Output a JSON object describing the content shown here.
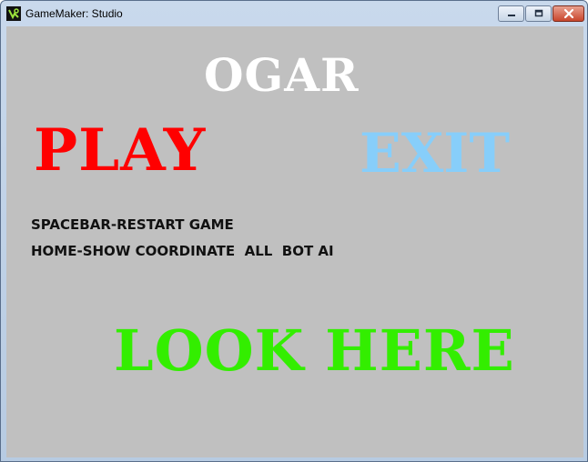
{
  "window": {
    "title": "GameMaker: Studio",
    "icon": "gamemaker-logo-icon",
    "controls": [
      "minimize-icon",
      "maximize-icon",
      "close-icon"
    ]
  },
  "game": {
    "background_color": "#c0c0c0",
    "title": "OGAR",
    "play_label": "PLAY",
    "exit_label": "EXIT",
    "help_lines": [
      "SPACEBAR-RESTART GAME",
      "HOME-SHOW COORDINATE  ALL  BOT AI"
    ],
    "look_label": "LOOK HERE",
    "colors": {
      "title": "#ffffff",
      "play": "#ff0000",
      "exit": "#87cefa",
      "help": "#111111",
      "look": "#33ee00"
    }
  }
}
